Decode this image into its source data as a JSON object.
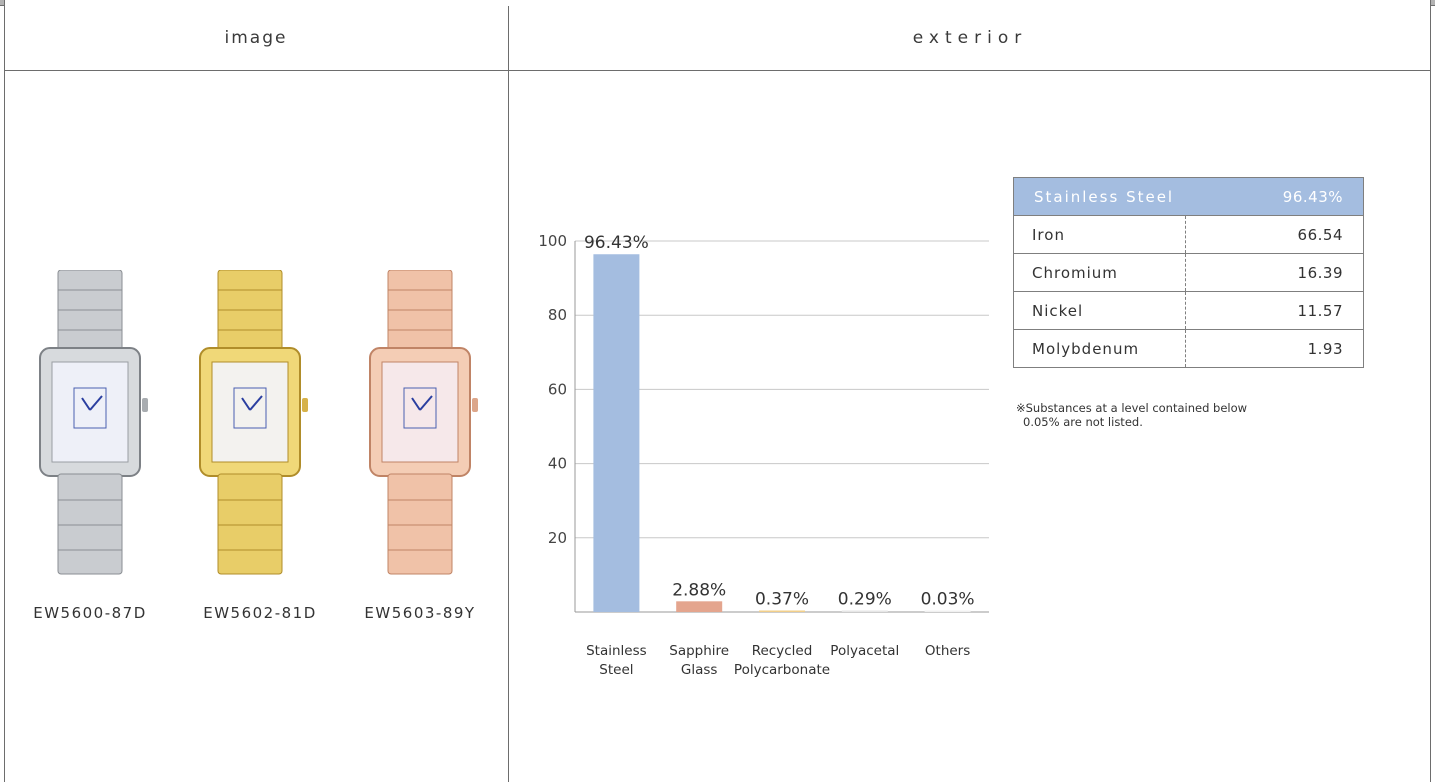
{
  "header": {
    "image_label": "image",
    "exterior_label": "exterior"
  },
  "models": [
    {
      "code": "EW5600-87D",
      "finish": "silver"
    },
    {
      "code": "EW5602-81D",
      "finish": "gold"
    },
    {
      "code": "EW5603-89Y",
      "finish": "rose-gold"
    }
  ],
  "colors": {
    "bar_steel": "#a4bde0",
    "bar_glass": "#e4a58e",
    "bar_recycled": "#f2cf8a",
    "bar_polyacetal": "#e6e6e6",
    "bar_others": "#f0f0f0",
    "table_header": "#a4bde0"
  },
  "chart_data": {
    "type": "bar",
    "categories": [
      [
        "Stainless",
        "Steel"
      ],
      [
        "Sapphire",
        "Glass"
      ],
      [
        "Recycled",
        "Polycarbonate"
      ],
      [
        "Polyacetal"
      ],
      [
        "Others"
      ]
    ],
    "values": [
      96.43,
      2.88,
      0.37,
      0.29,
      0.03
    ],
    "data_labels": [
      "96.43%",
      "2.88%",
      "0.37%",
      "0.29%",
      "0.03%"
    ],
    "yticks": [
      20,
      40,
      60,
      80,
      100
    ],
    "ylim": [
      0,
      100
    ],
    "grid": true
  },
  "composition": {
    "title": "Stainless Steel",
    "title_value": "96.43%",
    "rows": [
      {
        "element": "Iron",
        "value": "66.54"
      },
      {
        "element": "Chromium",
        "value": "16.39"
      },
      {
        "element": "Nickel",
        "value": "11.57"
      },
      {
        "element": "Molybdenum",
        "value": "1.93"
      }
    ]
  },
  "note": {
    "line1": "※Substances at a level contained below",
    "line2": "0.05% are not listed."
  }
}
